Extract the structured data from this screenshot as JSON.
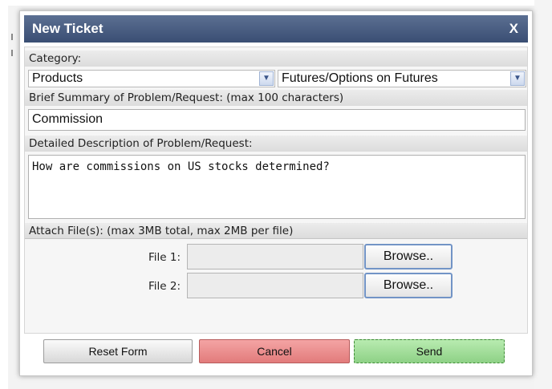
{
  "dialog": {
    "title": "New Ticket",
    "close_label": "X"
  },
  "form": {
    "category_label": "Category:",
    "category_primary": "Products",
    "category_secondary": "Futures/Options on Futures",
    "summary_label": "Brief Summary of Problem/Request: (max 100 characters)",
    "summary_value": "Commission",
    "description_label": "Detailed Description of Problem/Request:",
    "description_value": "How are commissions on US stocks determined?",
    "attach_label": "Attach File(s): (max 3MB total, max 2MB per file)",
    "files": [
      {
        "label": "File 1:",
        "browse_label": "Browse.."
      },
      {
        "label": "File 2:",
        "browse_label": "Browse.."
      }
    ]
  },
  "buttons": {
    "reset": "Reset Form",
    "cancel": "Cancel",
    "send": "Send"
  },
  "icons": {
    "dropdown_arrow": "chevron-down-icon",
    "close": "close-icon"
  },
  "colors": {
    "titlebar": "#3f5377",
    "cancel": "#e88a8a",
    "send": "#9fdc97",
    "browse_border": "#7294c6"
  }
}
